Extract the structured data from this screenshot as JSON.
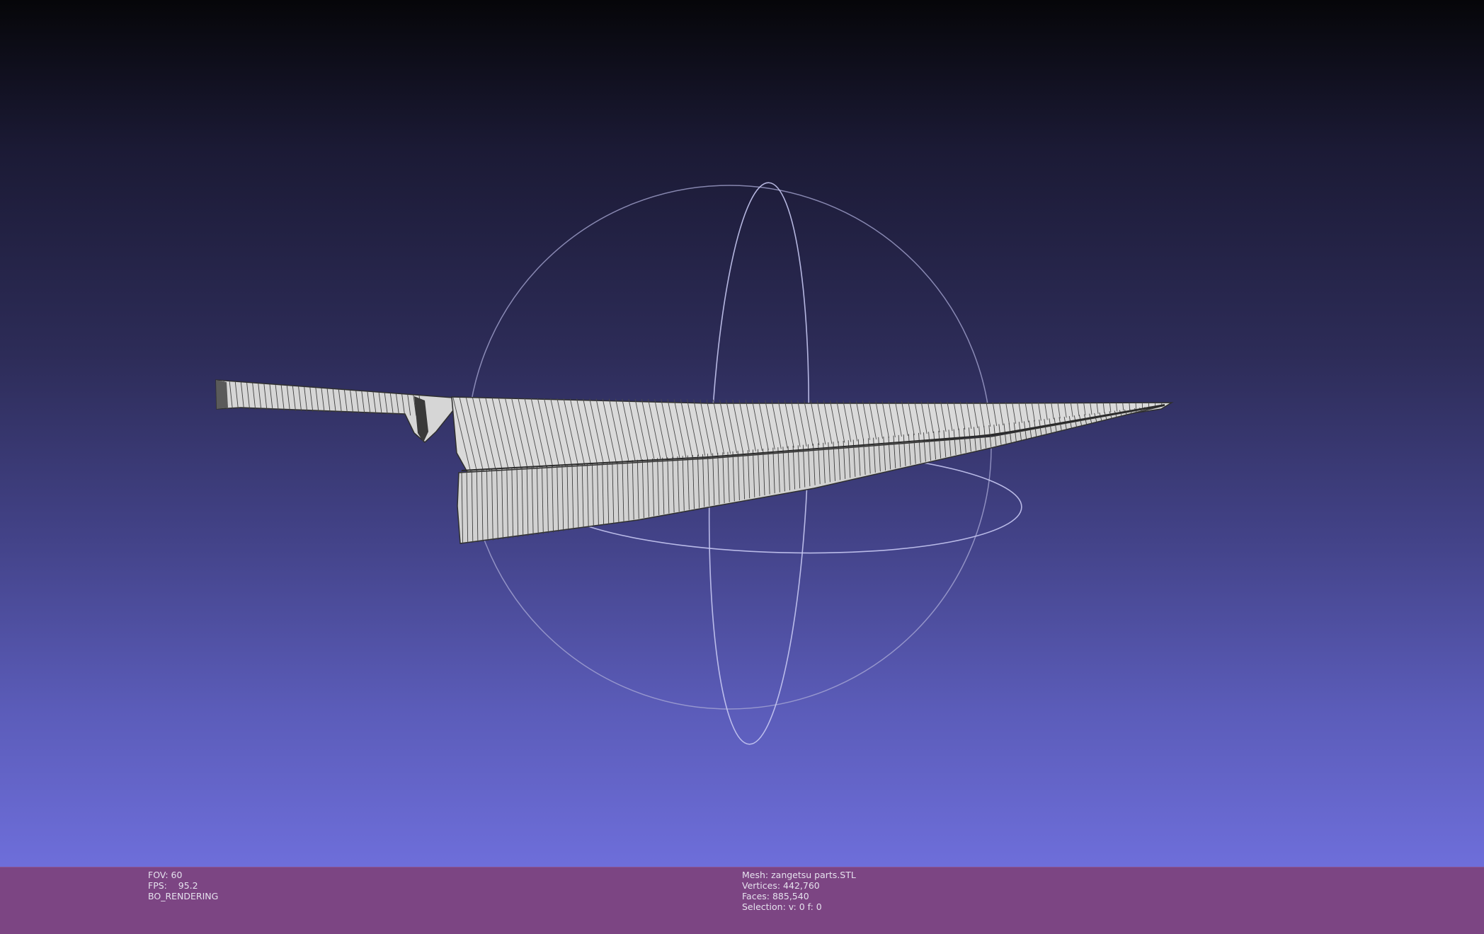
{
  "viewport": {
    "background_top": "#060609",
    "background_bottom": "#7676e8",
    "mesh_color": "#d9d9d9",
    "wire_color": "#3a3a3a",
    "trackball_color": "#b8b8e0"
  },
  "status_left": {
    "fov": "FOV: 60",
    "fps": "FPS:    95.2",
    "mode": "BO_RENDERING"
  },
  "status_right": {
    "mesh": "Mesh: zangetsu parts.STL",
    "vertices": "Vertices: 442,760",
    "faces": "Faces: 885,540",
    "selection": "Selection: v: 0 f: 0"
  },
  "info_bar_color": "#7c4583"
}
